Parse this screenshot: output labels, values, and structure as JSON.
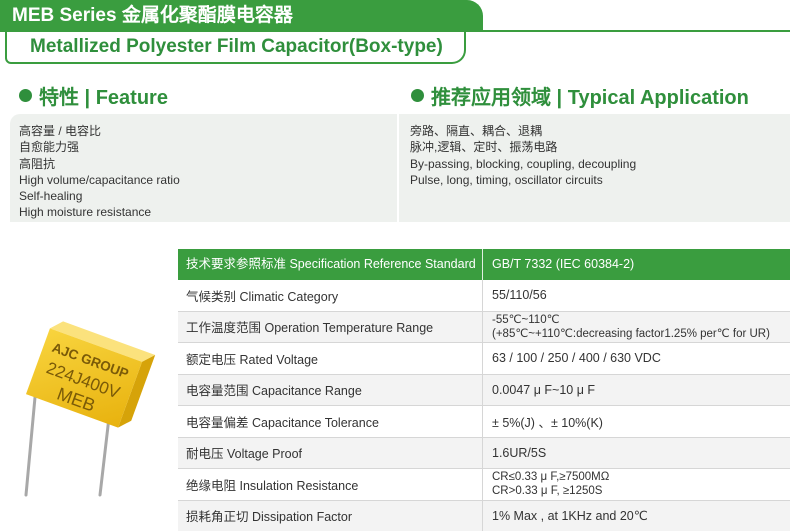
{
  "header": {
    "series_title": "MEB Series 金属化聚酯膜电容器",
    "product_title": "Metallized Polyester Film Capacitor(Box-type)"
  },
  "feature": {
    "title": "特性 | Feature",
    "items": [
      "高容量 / 电容比",
      "自愈能力强",
      "高阻抗",
      "High volume/capacitance ratio",
      "Self-healing",
      "High moisture resistance"
    ]
  },
  "application": {
    "title": "推荐应用领域 | Typical Application",
    "items": [
      "旁路、隔直、耦合、退耦",
      "脉冲,逻辑、定时、振荡电路",
      "By-passing, blocking, coupling, decoupling",
      "Pulse, long, timing, oscillator circuits"
    ]
  },
  "product_image": {
    "marking": [
      "AJC GROUP",
      "224J400V",
      "MEB"
    ],
    "body_color": "#f2c417",
    "lead_color": "#a8a8a8"
  },
  "spec_table": {
    "header": {
      "label": "技术要求参照标准 Specification Reference Standard",
      "value": "GB/T 7332 (IEC 60384-2)"
    },
    "rows": [
      {
        "label": "气候类别 Climatic Category",
        "lines": [
          "55/110/56"
        ]
      },
      {
        "label": "工作温度范围 Operation Temperature Range",
        "lines": [
          "-55℃~110℃",
          "(+85℃~+110℃:decreasing factor1.25% per℃ for UR)"
        ]
      },
      {
        "label": "额定电压 Rated Voltage",
        "lines": [
          "63 / 100 / 250 / 400 / 630 VDC"
        ]
      },
      {
        "label": "电容量范围 Capacitance Range",
        "lines": [
          "0.0047 μ F~10 μ F"
        ]
      },
      {
        "label": "电容量偏差 Capacitance Tolerance",
        "lines": [
          "± 5%(J) 、± 10%(K)"
        ]
      },
      {
        "label": "耐电压 Voltage Proof",
        "lines": [
          "1.6UR/5S"
        ]
      },
      {
        "label": "绝缘电阻 Insulation Resistance",
        "lines": [
          "CR≤0.33 μ F,≥7500MΩ",
          "CR>0.33 μ F, ≥1250S"
        ]
      },
      {
        "label": "损耗角正切 Dissipation Factor",
        "lines": [
          "1% Max , at 1KHz and 20℃"
        ]
      }
    ]
  },
  "colors": {
    "brand_green": "#3a9d3f",
    "heading_green": "#2f8f3c",
    "feature_bg": "#eef1ee",
    "row_alt": "#f3f3f3"
  }
}
